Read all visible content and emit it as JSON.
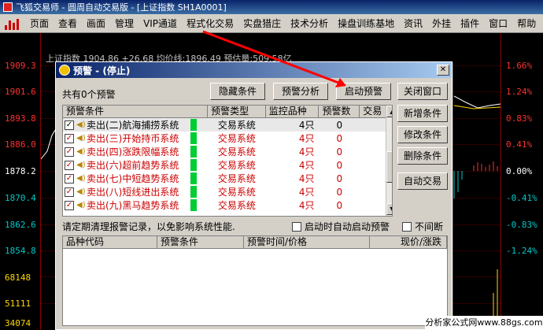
{
  "window": {
    "title": "飞狐交易师 - 圆周自动交易版 - [上证指数 SH1A0001]"
  },
  "menu": [
    "页面",
    "查看",
    "画面",
    "管理",
    "VIP通道",
    "程式化交易",
    "实盘猎庄",
    "技术分析",
    "操盘训练基地",
    "资讯",
    "外挂",
    "插件",
    "窗口",
    "帮助"
  ],
  "chart": {
    "info": "上证指数 1904.86 +26.68 均价线:1896.49 预估量:509.58亿",
    "left_labels": [
      "1909.3",
      "1901.6",
      "1893.8",
      "1886.0",
      "1878.2",
      "1870.4",
      "1862.6",
      "1854.8",
      "68148",
      "51111",
      "34074"
    ],
    "right_labels": [
      "1.66%",
      "1.24%",
      "0.83%",
      "0.41%",
      "0.00%",
      "-0.41%",
      "-0.83%",
      "-1.24%"
    ],
    "colors": {
      "up": "#ff3030",
      "down": "#00c8c8",
      "neutral": "#ffffff",
      "volume": "#ffd700"
    }
  },
  "dialog": {
    "title": "预警 - (停止)",
    "count_label": "共有0个预警",
    "buttons": {
      "hide_conditions": "隐藏条件",
      "analysis": "预警分析",
      "start": "启动预警",
      "close": "关闭窗口",
      "add": "新增条件",
      "modify": "修改条件",
      "delete": "删除条件",
      "auto_trade": "自动交易"
    },
    "list_headers": [
      "预警条件",
      "预警类型",
      "监控品种",
      "预警数",
      "交易"
    ],
    "rows": [
      {
        "name": "卖出(二)航海捕捞系统",
        "type": "交易系统",
        "monitor": "4只",
        "count": "0",
        "red": false
      },
      {
        "name": "卖出(三)开始持币系统",
        "type": "交易系统",
        "monitor": "4只",
        "count": "0",
        "red": true
      },
      {
        "name": "卖出(四)涨跌限幅系统",
        "type": "交易系统",
        "monitor": "4只",
        "count": "0",
        "red": true
      },
      {
        "name": "卖出(六)超前趋势系统",
        "type": "交易系统",
        "monitor": "4只",
        "count": "0",
        "red": true
      },
      {
        "name": "卖出(七)中短趋势系统",
        "type": "交易系统",
        "monitor": "4只",
        "count": "0",
        "red": true
      },
      {
        "name": "卖出(八)短线进出系统",
        "type": "交易系统",
        "monitor": "4只",
        "count": "0",
        "red": true
      },
      {
        "name": "卖出(九)黑马趋势系统",
        "type": "交易系统",
        "monitor": "4只",
        "count": "0",
        "red": true
      }
    ],
    "note": "请定期清理报警记录，以免影响系统性能.",
    "opt_auto_start": "启动时自动启动预警",
    "opt_no_interrupt": "不间断",
    "log_headers": [
      "品种代码",
      "预警条件",
      "预警时间/价格",
      "现价/涨跌"
    ]
  },
  "watermark": "分析家公式网www.88gs.com"
}
